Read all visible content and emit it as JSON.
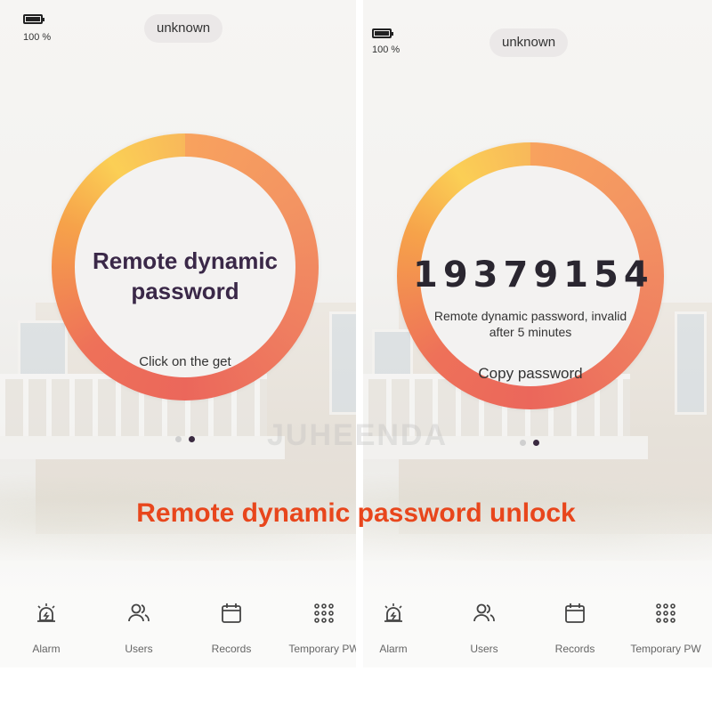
{
  "left_screen": {
    "battery_text": "100 %",
    "device_name": "unknown",
    "title_line1": "Remote dynamic",
    "title_line2": "password",
    "action_text": "Click on the get"
  },
  "right_screen": {
    "battery_text": "100 %",
    "device_name": "unknown",
    "password_digits": "19379154",
    "hint_line1": "Remote dynamic password, invalid",
    "hint_line2": "after 5 minutes",
    "action_text": "Copy password"
  },
  "battery_level": 1.0,
  "nav_items": [
    {
      "label": "Alarm",
      "icon": "alarm-icon"
    },
    {
      "label": "Users",
      "icon": "users-icon"
    },
    {
      "label": "Records",
      "icon": "calendar-icon"
    },
    {
      "label": "Temporary PW",
      "icon": "keypad-icon"
    }
  ],
  "page_indicator": {
    "total": 2,
    "active": 2
  },
  "watermark": "JUHEENDA",
  "caption": "Remote dynamic password unlock",
  "colors": {
    "caption": "#e8461c",
    "title": "#3a2848",
    "ring_start": "#fbcf55",
    "ring_end": "#eb675b"
  }
}
